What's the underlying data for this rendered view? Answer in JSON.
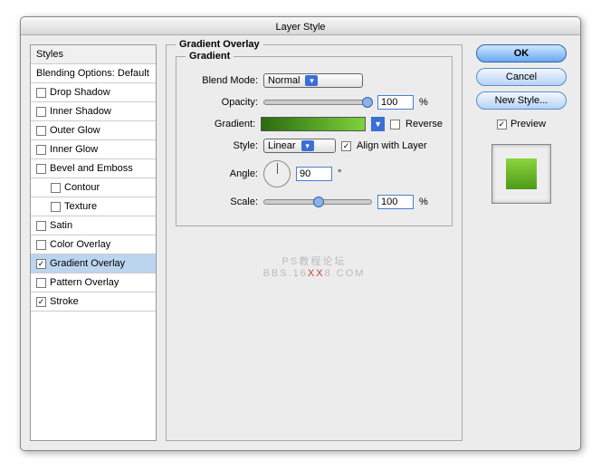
{
  "window": {
    "title": "Layer Style"
  },
  "sidebar": {
    "header": "Styles",
    "blending": "Blending Options: Default",
    "items": [
      {
        "label": "Drop Shadow",
        "checked": false
      },
      {
        "label": "Inner Shadow",
        "checked": false
      },
      {
        "label": "Outer Glow",
        "checked": false
      },
      {
        "label": "Inner Glow",
        "checked": false
      },
      {
        "label": "Bevel and Emboss",
        "checked": false
      },
      {
        "label": "Contour",
        "checked": false,
        "sub": true
      },
      {
        "label": "Texture",
        "checked": false,
        "sub": true
      },
      {
        "label": "Satin",
        "checked": false
      },
      {
        "label": "Color Overlay",
        "checked": false
      },
      {
        "label": "Gradient Overlay",
        "checked": true,
        "selected": true
      },
      {
        "label": "Pattern Overlay",
        "checked": false
      },
      {
        "label": "Stroke",
        "checked": true
      }
    ]
  },
  "main": {
    "group_title": "Gradient Overlay",
    "inner_title": "Gradient",
    "blend_mode": {
      "label": "Blend Mode:",
      "value": "Normal"
    },
    "opacity": {
      "label": "Opacity:",
      "value": "100",
      "unit": "%"
    },
    "gradient": {
      "label": "Gradient:",
      "reverse_label": "Reverse",
      "reverse": false
    },
    "style": {
      "label": "Style:",
      "value": "Linear",
      "align_label": "Align with Layer",
      "align": true
    },
    "angle": {
      "label": "Angle:",
      "value": "90",
      "unit": "°"
    },
    "scale": {
      "label": "Scale:",
      "value": "100",
      "unit": "%"
    }
  },
  "buttons": {
    "ok": "OK",
    "cancel": "Cancel",
    "new_style": "New Style...",
    "preview": "Preview"
  },
  "watermark": {
    "line1": "PS教程论坛",
    "line2a": "BBS.16",
    "line2b": "XX",
    "line2c": "8.COM"
  }
}
